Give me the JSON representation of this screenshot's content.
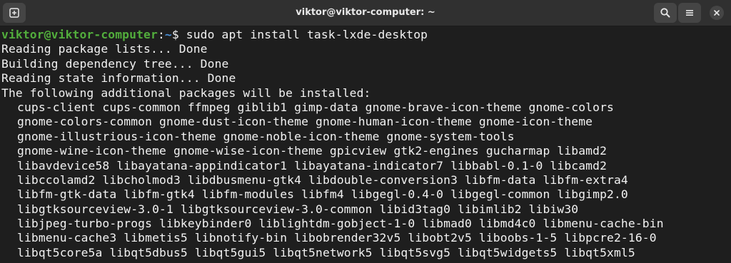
{
  "window": {
    "title": "viktor@viktor-computer: ~",
    "colors": {
      "background": "#1e1e1e",
      "titlebar": "#303030",
      "text": "#f2f2f2",
      "prompt_user": "#52ad3c",
      "prompt_path": "#4a8fd6"
    }
  },
  "titlebar": {
    "new_tab_icon": "new-tab-icon",
    "search_icon": "search-icon",
    "menu_icon": "hamburger-menu-icon",
    "close_icon": "close-icon"
  },
  "terminal": {
    "prompt": {
      "user_host": "viktor@viktor-computer",
      "separator": ":",
      "path": "~",
      "symbol": "$ ",
      "command": "sudo apt install task-lxde-desktop"
    },
    "output": [
      "Reading package lists... Done",
      "Building dependency tree... Done",
      "Reading state information... Done",
      "The following additional packages will be installed:"
    ],
    "packages": [
      "cups-client cups-common ffmpeg giblib1 gimp-data gnome-brave-icon-theme gnome-colors",
      "gnome-colors-common gnome-dust-icon-theme gnome-human-icon-theme gnome-icon-theme",
      "gnome-illustrious-icon-theme gnome-noble-icon-theme gnome-system-tools",
      "gnome-wine-icon-theme gnome-wise-icon-theme gpicview gtk2-engines gucharmap libamd2",
      "libavdevice58 libayatana-appindicator1 libayatana-indicator7 libbabl-0.1-0 libcamd2",
      "libccolamd2 libcholmod3 libdbusmenu-gtk4 libdouble-conversion3 libfm-data libfm-extra4",
      "libfm-gtk-data libfm-gtk4 libfm-modules libfm4 libgegl-0.4-0 libgegl-common libgimp2.0",
      "libgtksourceview-3.0-1 libgtksourceview-3.0-common libid3tag0 libimlib2 libiw30",
      "libjpeg-turbo-progs libkeybinder0 liblightdm-gobject-1-0 libmad0 libmd4c0 libmenu-cache-bin",
      "libmenu-cache3 libmetis5 libnotify-bin libobrender32v5 libobt2v5 liboobs-1-5 libpcre2-16-0",
      "libqt5core5a libqt5dbus5 libqt5gui5 libqt5network5 libqt5svg5 libqt5widgets5 libqt5xml5"
    ]
  }
}
